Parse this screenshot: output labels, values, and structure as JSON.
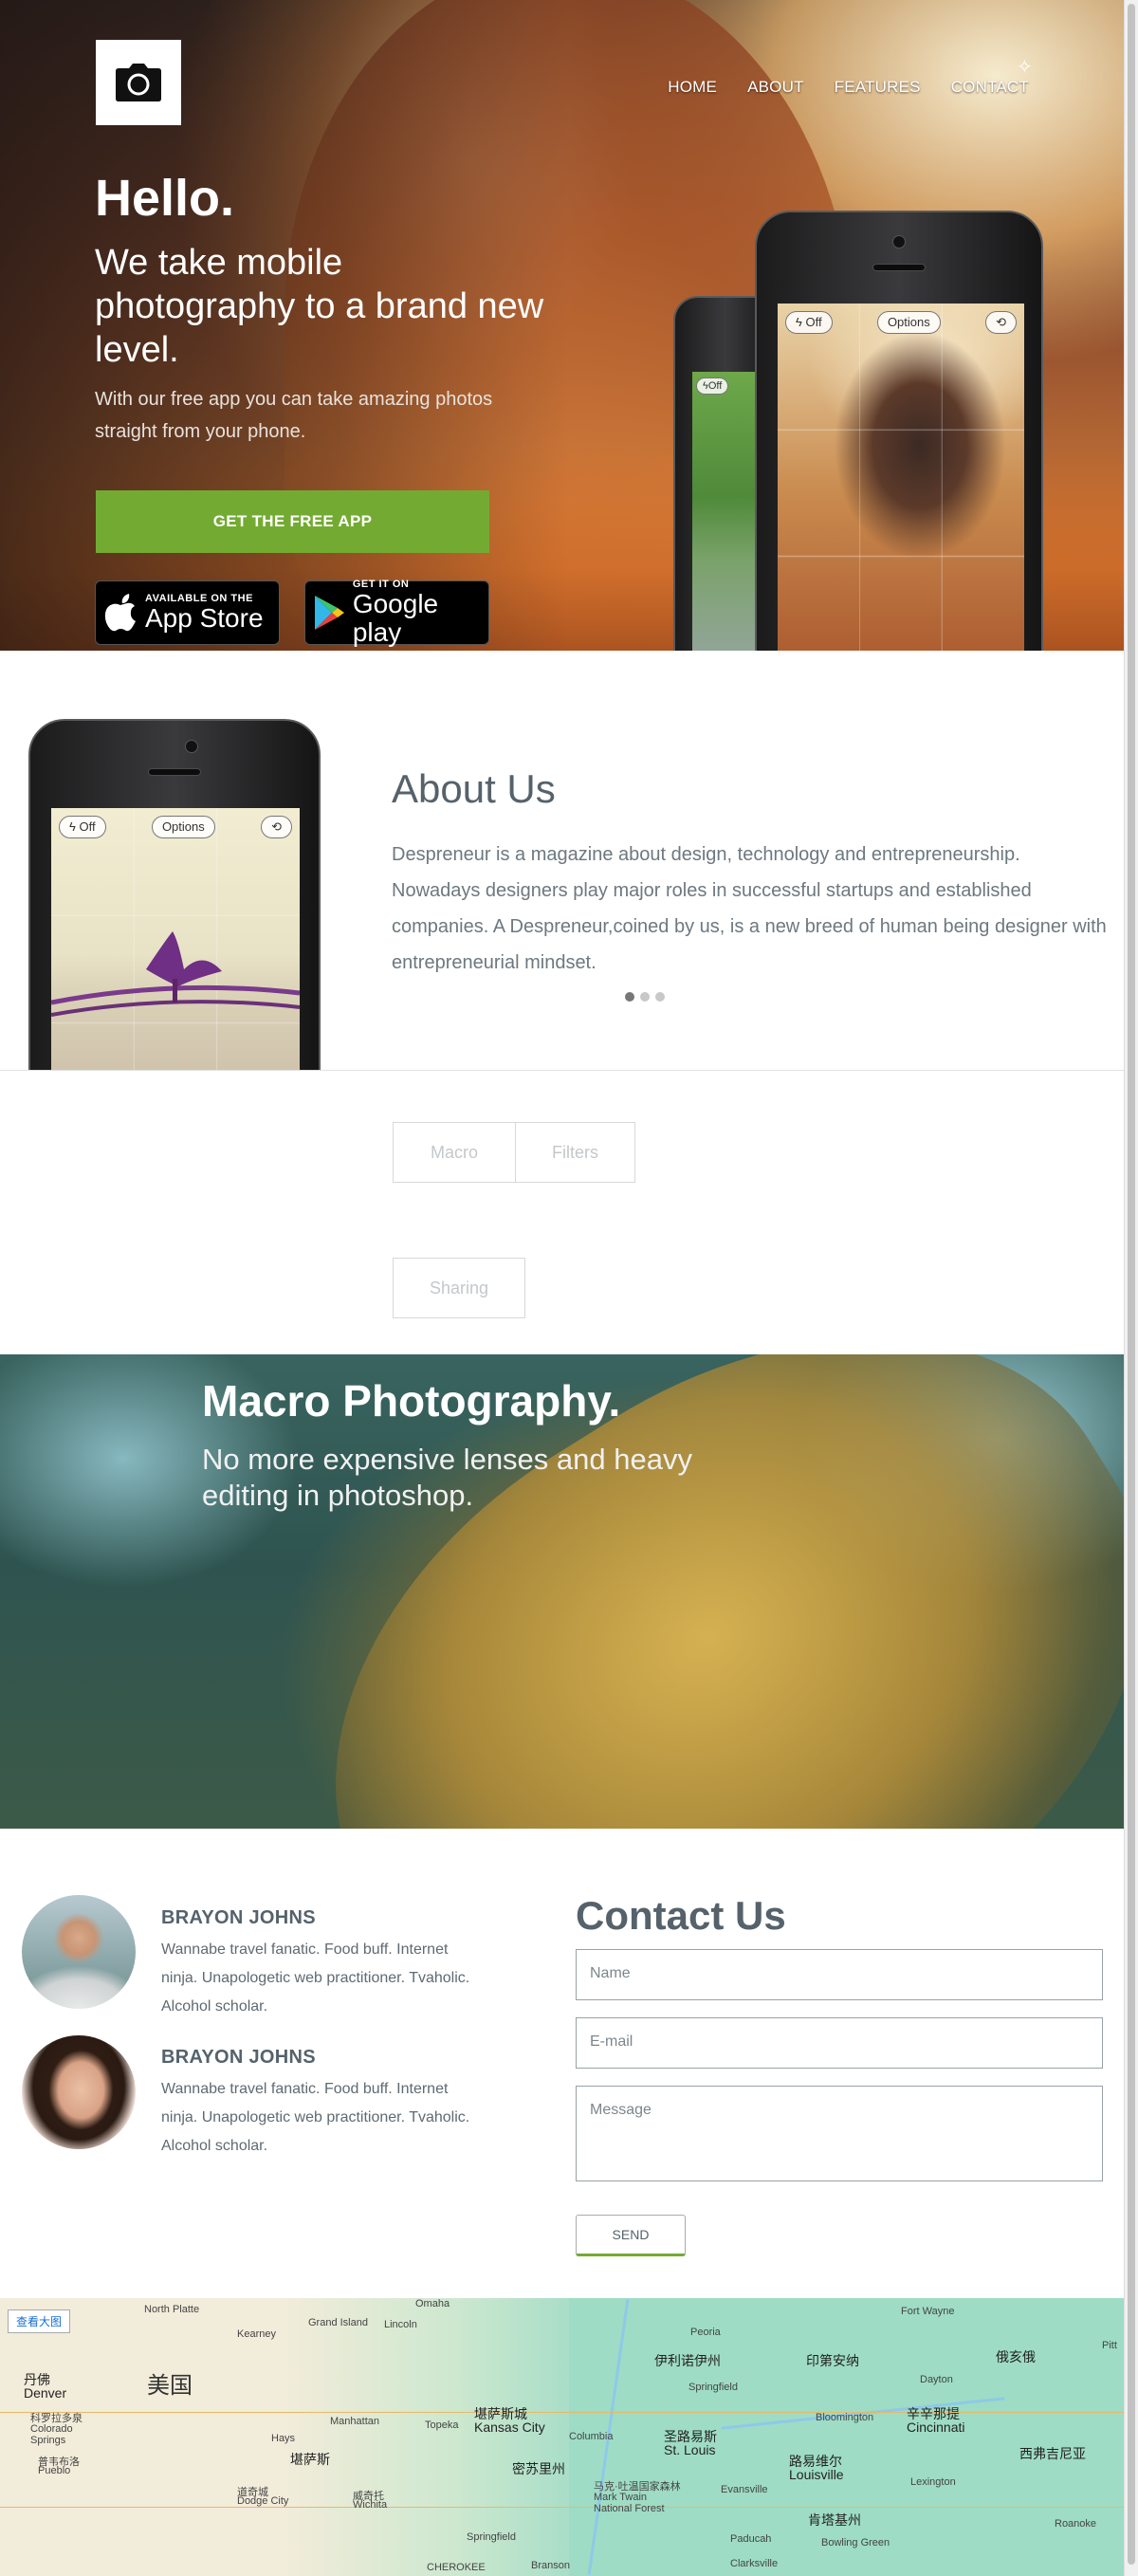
{
  "nav": {
    "items": [
      "HOME",
      "ABOUT",
      "FEATURES",
      "CONTACT"
    ]
  },
  "hero": {
    "title": "Hello.",
    "subtitle": "We take mobile photography to a brand new level.",
    "lead": "With our free app you can take amazing photos straight from your phone.",
    "cta": "GET THE FREE APP",
    "appstore": {
      "small": "AVAILABLE ON THE",
      "big": "App Store"
    },
    "gplay": {
      "small": "GET IT ON",
      "big": "Google play"
    },
    "camera_ui": {
      "off": "Off",
      "options": "Options"
    }
  },
  "about": {
    "title": "About Us",
    "text": "Despreneur is a magazine about design, technology and entrepreneurship. Nowadays designers play major roles in successful startups and established companies. A Despreneur,coined by us, is a new breed of human being designer with entrepreneurial mindset.",
    "slide_active": 1,
    "slide_count": 3
  },
  "tabs": [
    "Macro",
    "Filters",
    "Sharing"
  ],
  "macro": {
    "title": "Macro Photography.",
    "text": "No more expensive lenses and heavy editing in photoshop."
  },
  "team": [
    {
      "name": "BRAYON JOHNS",
      "bio": "Wannabe travel fanatic. Food buff. Internet ninja. Unapologetic web practitioner. Tvaholic. Alcohol scholar."
    },
    {
      "name": "BRAYON JOHNS",
      "bio": "Wannabe travel fanatic. Food buff. Internet ninja. Unapologetic web practitioner. Tvaholic. Alcohol scholar."
    }
  ],
  "contact": {
    "title": "Contact Us",
    "name_placeholder": "Name",
    "email_placeholder": "E-mail",
    "message_placeholder": "Message",
    "send": "SEND"
  },
  "map": {
    "view_larger": "查看大图",
    "country": "美国",
    "labels": {
      "denver_cn": "丹佛",
      "denver": "Denver",
      "colorado_cn": "科罗拉多泉",
      "colorado": "Colorado",
      "springs": "Springs",
      "pueblo_cn": "普韦布洛",
      "pueblo": "Pueblo",
      "kansas_cn": "堪萨斯",
      "kc_cn": "堪萨斯城",
      "kc": "Kansas City",
      "wichita_cn": "威奇托",
      "wichita": "Wichita",
      "stl_cn": "圣路易斯",
      "stl": "St. Louis",
      "louisville_cn": "路易维尔",
      "louisville": "Louisville",
      "cincy_cn": "辛辛那提",
      "cincy": "Cincinnati",
      "indy_cn": "印第安纳",
      "ohio_cn": "俄亥俄",
      "illinois_cn": "伊利诺伊州",
      "missouri_cn": "密苏里州",
      "kentucky_cn": "肯塔基州",
      "wv_cn": "西弗吉尼亚",
      "omaha": "Omaha",
      "lincoln": "Lincoln",
      "topeka": "Topeka",
      "springfield": "Springfield",
      "columbia": "Columbia",
      "manhattan": "Manhattan",
      "dodge_cn": "道奇城",
      "dodge": "Dodge City",
      "hays": "Hays",
      "peoria": "Peoria",
      "dayton": "Dayton",
      "fortwayne": "Fort Wayne",
      "bloomington": "Bloomington",
      "evansville": "Evansville",
      "lexington": "Lexington",
      "bowling": "Bowling Green",
      "markTwain_cn": "马克·吐温国家森林",
      "markTwain": "Mark Twain",
      "nf": "National Forest",
      "northplatte": "North Platte",
      "grandisland": "Grand Island",
      "kearney": "Kearney",
      "paducah": "Paducah",
      "clarksville": "Clarksville",
      "branson": "Branson",
      "roanoke": "Roanoke",
      "cherokee": "CHEROKEE",
      "pitt": "Pitt"
    }
  }
}
